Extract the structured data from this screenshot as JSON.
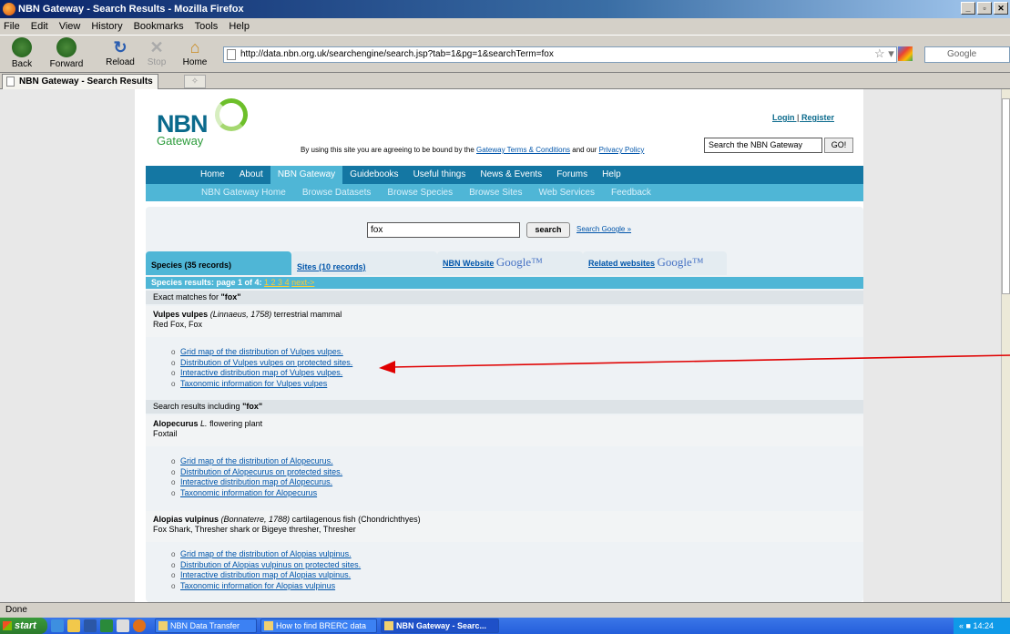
{
  "window": {
    "title": "NBN Gateway - Search Results - Mozilla Firefox"
  },
  "menu": [
    "File",
    "Edit",
    "View",
    "History",
    "Bookmarks",
    "Tools",
    "Help"
  ],
  "toolbar": {
    "back": "Back",
    "forward": "Forward",
    "reload": "Reload",
    "stop": "Stop",
    "home": "Home"
  },
  "url": "http://data.nbn.org.uk/searchengine/search.jsp?tab=1&pg=1&searchTerm=fox",
  "search_engine_placeholder": "Google",
  "tab": {
    "label": "NBN Gateway - Search Results"
  },
  "site": {
    "logo": "NBN",
    "logo_sub": "Gateway",
    "login": "Login",
    "register": "Register",
    "login_sep": " | ",
    "terms_prefix": "By using this site you are agreeing to be bound by the ",
    "terms_link": "Gateway Terms & Conditions",
    "terms_mid": " and our ",
    "privacy_link": "Privacy Policy",
    "search_box": "Search the NBN Gateway",
    "go": "GO!",
    "nav_main": [
      "Home",
      "About",
      "NBN Gateway",
      "Guidebooks",
      "Useful things",
      "News & Events",
      "Forums",
      "Help"
    ],
    "nav_sub": [
      "NBN Gateway Home",
      "Browse Datasets",
      "Browse Species",
      "Browse Sites",
      "Web Services",
      "Feedback"
    ]
  },
  "search": {
    "value": "fox",
    "button": "search",
    "google_link": "Search Google »"
  },
  "tabs": {
    "species": "Species (35 records)",
    "sites": "Sites (10 records)",
    "nbn_website": "NBN Website",
    "related": "Related websites",
    "google": "Google™"
  },
  "results_bar": {
    "text": "Species results: page 1 of 4: ",
    "pages": "1 2 3 4",
    "next": "next->"
  },
  "exact_header": {
    "prefix": "Exact matches for ",
    "term": "\"fox\""
  },
  "including_header": {
    "prefix": "Search results including ",
    "term": "\"fox\""
  },
  "records": [
    {
      "name": "Vulpes vulpes",
      "authority": "(Linnaeus, 1758)",
      "type": "terrestrial mammal",
      "common": "Red Fox, Fox",
      "links": [
        "Grid map of the distribution of Vulpes vulpes.",
        "Distribution of Vulpes vulpes on protected sites.",
        "Interactive distribution map of Vulpes vulpes.",
        "Taxonomic information for Vulpes vulpes"
      ]
    },
    {
      "name": "Alopecurus",
      "authority": "L.",
      "type": "flowering plant",
      "common": "Foxtail",
      "links": [
        "Grid map of the distribution of Alopecurus.",
        "Distribution of Alopecurus on protected sites.",
        "Interactive distribution map of Alopecurus.",
        "Taxonomic information for Alopecurus"
      ]
    },
    {
      "name": "Alopias vulpinus",
      "authority": "(Bonnaterre, 1788)",
      "type": "cartilagenous fish (Chondrichthyes)",
      "common": "Fox Shark, Thresher shark or Bigeye thresher, Thresher",
      "links": [
        "Grid map of the distribution of Alopias vulpinus.",
        "Distribution of Alopias vulpinus on protected sites.",
        "Interactive distribution map of Alopias vulpinus.",
        "Taxonomic information for Alopias vulpinus"
      ]
    }
  ],
  "status": "Done",
  "taskbar": {
    "start": "start",
    "tasks": [
      "NBN Data Transfer",
      "How to find BRERC data ...",
      "NBN Gateway - Searc..."
    ],
    "clock": "14:24"
  },
  "colors": {
    "nav_dark": "#1477a3",
    "nav_light": "#4fb6d6",
    "annotation_arrow": "#e00000"
  }
}
